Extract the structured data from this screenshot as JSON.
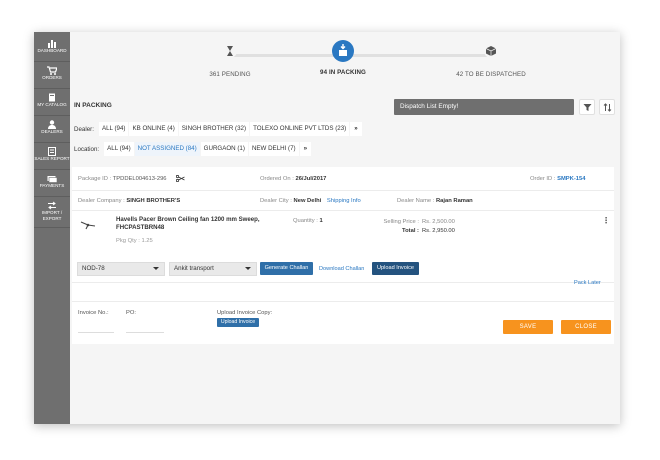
{
  "sidebar": {
    "items": [
      {
        "label": "DASHBOARD",
        "icon": "bar-chart-icon"
      },
      {
        "label": "ORDERS",
        "icon": "cart-icon"
      },
      {
        "label": "MY CATALOG",
        "icon": "book-icon"
      },
      {
        "label": "DEALERS",
        "icon": "user-icon"
      },
      {
        "label": "SALES REPORT",
        "icon": "report-icon"
      },
      {
        "label": "PAYMENTS",
        "icon": "cash-icon"
      },
      {
        "label": "IMPORT / EXPORT",
        "icon": "transfer-icon"
      }
    ]
  },
  "tracker": {
    "steps": [
      {
        "label": "361 PENDING",
        "icon": "hourglass-icon"
      },
      {
        "label": "94 IN PACKING",
        "icon": "packing-icon"
      },
      {
        "label": "42 TO BE DISPATCHED",
        "icon": "box-icon"
      }
    ],
    "active_index": 1
  },
  "section_title": "IN PACKING",
  "dispatch_box": "Dispatch List Empty!",
  "dealer_filter": {
    "label": "Dealer:",
    "chips": [
      "ALL (94)",
      "KB ONLINE (4)",
      "SINGH BROTHER (32)",
      "TOLEXO ONLINE PVT LTDS (23)"
    ],
    "more": "»"
  },
  "location_filter": {
    "label": "Location:",
    "chips": [
      "ALL (94)",
      "NOT ASSIGNED (84)",
      "GURGAON (1)",
      "NEW DELHI (7)"
    ],
    "selected_index": 1,
    "more": "»"
  },
  "order": {
    "package_label": "Package ID :",
    "package_id": "TPDDEL004613-296",
    "ordered_label": "Ordered On :",
    "ordered_on": "26/Jul/2017",
    "order_label": "Order ID :",
    "order_id": "SMPK-154",
    "company_label": "Dealer Company :",
    "company": "SINGH BROTHER'S",
    "city_label": "Dealer City :",
    "city": "New Delhi",
    "shipping_link": "Shipping Info",
    "dealer_name_label": "Dealer Name :",
    "dealer_name": "Rajan Raman"
  },
  "product": {
    "name": "Havells Pacer Brown Ceiling fan 1200 mm Sweep, FHCPASTBRN48",
    "pkg_qty": "Pkg Qty : 1.25",
    "quantity_label": "Quantity :",
    "quantity": "1",
    "selling_label": "Selling Price :",
    "selling_price": "Rs. 2,500.00",
    "total_label": "Total :",
    "total": "Rs. 2,950.00",
    "menu": "⋮"
  },
  "actions": {
    "vehicle": "NOD-78",
    "transport": "Ankit transport",
    "generate_challan": "Generate Challan",
    "download_challan": "Download Challan",
    "upload_invoice": "Upload Invoice",
    "pack_later": "Pack Later"
  },
  "invoice": {
    "invoice_label": "Invoice No.:",
    "po_label": "PO:",
    "upload_copy_label": "Upload Invoice Copy:",
    "upload_button": "Upload Invoice",
    "save": "SAVE",
    "close": "CLOSE"
  },
  "colors": {
    "sidebar": "#6f6f6f",
    "accent_blue": "#2a78c2",
    "button_blue": "#2f6fa8",
    "button_navy": "#24537f",
    "orange": "#f7931e"
  }
}
